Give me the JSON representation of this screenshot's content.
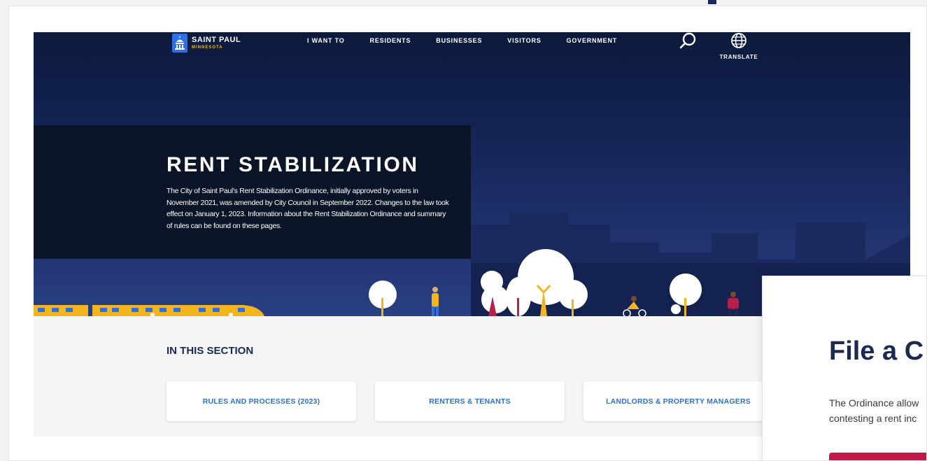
{
  "site": {
    "name": "SAINT PAUL",
    "state": "MINNESOTA"
  },
  "nav": {
    "links": [
      "I WANT TO",
      "RESIDENTS",
      "BUSINESSES",
      "VISITORS",
      "GOVERNMENT"
    ],
    "translate_label": "TRANSLATE"
  },
  "hero": {
    "title": "RENT STABILIZATION",
    "description": "The City of Saint Paul's Rent Stabilization Ordinance, initially approved by voters in November 2021, was amended by City Council in September 2022. Changes to the law took effect on January 1, 2023. Information about the Rent Stabilization Ordinance and summary of rules can be found on these pages."
  },
  "section": {
    "heading": "IN THIS SECTION",
    "cards": [
      "RULES AND PROCESSES (2023)",
      "RENTERS & TENANTS",
      "LANDLORDS & PROPERTY MANAGERS"
    ]
  },
  "overlay": {
    "title": "File a C",
    "text_line1": "The Ordinance allow",
    "text_line2": "contesting a rent inc"
  },
  "colors": {
    "navy": "#0c1a3c",
    "accent_blue": "#2f6fd0",
    "gold": "#f2b51e",
    "crimson": "#c4174a"
  },
  "icons": [
    "capitol-logo-icon",
    "search-icon",
    "globe-icon"
  ]
}
